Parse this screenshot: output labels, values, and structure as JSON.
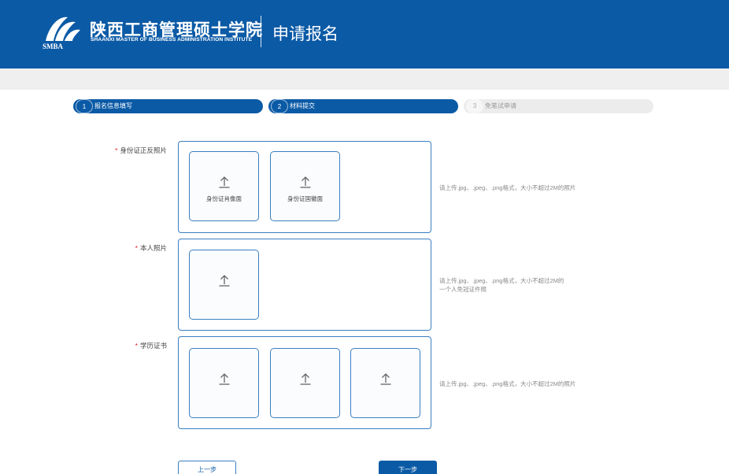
{
  "header": {
    "org_name_cn": "陕西工商管理硕士学院",
    "org_name_en": "SHAANXI MASTER OF BUSINESS ADMINISTRATION INSTITUTE",
    "logo_text": "SMBA",
    "page_title": "申请报名"
  },
  "steps": [
    {
      "number": "1",
      "label": "报名信息填写",
      "state": "active"
    },
    {
      "number": "2",
      "label": "材料提交",
      "state": "active"
    },
    {
      "number": "3",
      "label": "免笔试申请",
      "state": "inactive"
    }
  ],
  "fields": {
    "id_card": {
      "label": "身份证正反照片",
      "uploads": [
        "身份证肖像面",
        "身份证国徽面"
      ],
      "hint": "请上传.jpg、.jpeg、.png格式，大小不超过2M的照片"
    },
    "photo": {
      "label": "本人照片",
      "hint_line1": "请上传.jpg、.jpeg、.png格式，大小不超过2M的",
      "hint_line2": "一个人免冠证件照"
    },
    "diploma": {
      "label": "学历证书",
      "hint": "请上传.jpg、.jpeg、.png格式，大小不超过2M的照片"
    }
  },
  "required_mark": "*",
  "buttons": {
    "prev": "上一步",
    "next": "下一步"
  },
  "colors": {
    "brand": "#0b5aa6",
    "required": "#e02020",
    "border": "#3a7fc1"
  }
}
